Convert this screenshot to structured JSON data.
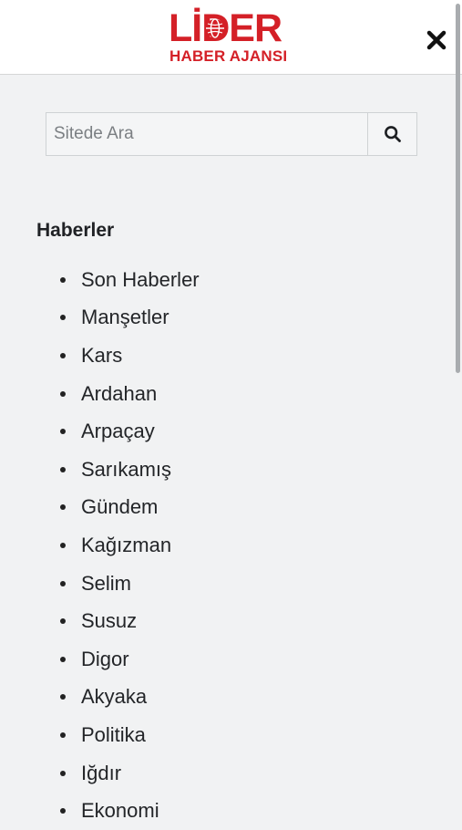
{
  "header": {
    "logo_main": "LİDER",
    "logo_sub": "HABER AJANSI",
    "brand_color": "#d42027",
    "close_icon": "close-icon"
  },
  "search": {
    "placeholder": "Sitede Ara",
    "value": "",
    "icon": "search-icon"
  },
  "nav": {
    "section_title": "Haberler",
    "items": [
      {
        "label": "Son Haberler"
      },
      {
        "label": "Manşetler"
      },
      {
        "label": "Kars"
      },
      {
        "label": "Ardahan"
      },
      {
        "label": "Arpaçay"
      },
      {
        "label": "Sarıkamış"
      },
      {
        "label": "Gündem"
      },
      {
        "label": "Kağızman"
      },
      {
        "label": "Selim"
      },
      {
        "label": "Susuz"
      },
      {
        "label": "Digor"
      },
      {
        "label": "Akyaka"
      },
      {
        "label": "Politika"
      },
      {
        "label": "Iğdır"
      },
      {
        "label": "Ekonomi"
      }
    ]
  }
}
